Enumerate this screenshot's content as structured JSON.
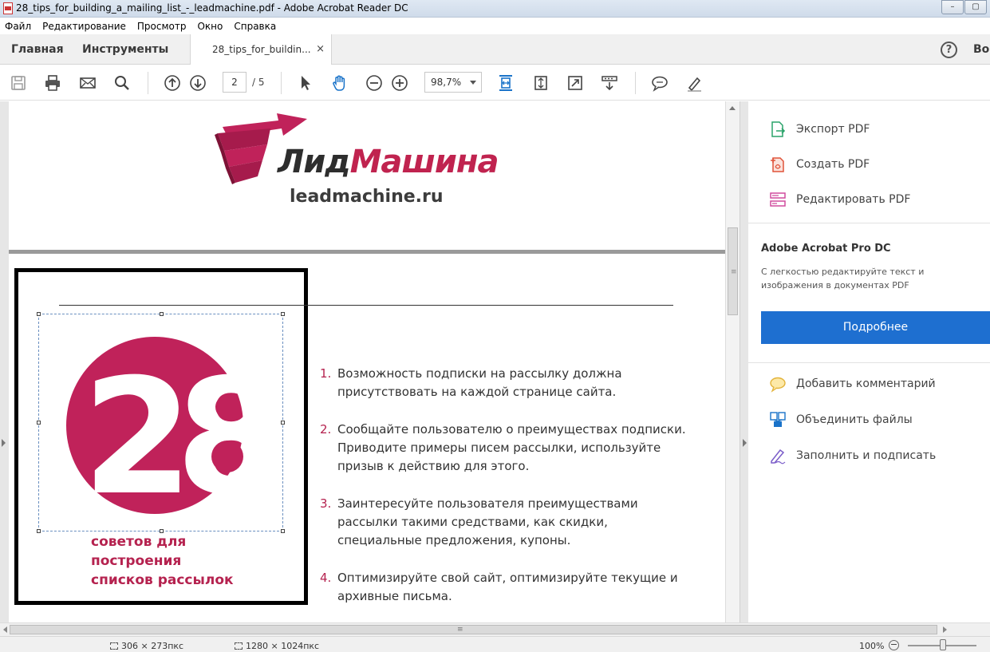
{
  "window": {
    "title": "28_tips_for_building_a_mailing_list_-_leadmachine.pdf - Adobe Acrobat Reader DC",
    "buttons": [
      "–",
      "▢"
    ]
  },
  "menu": [
    "Файл",
    "Редактирование",
    "Просмотр",
    "Окно",
    "Справка"
  ],
  "tabs": {
    "home": "Главная",
    "tools": "Инструменты",
    "document": "28_tips_for_buildin...",
    "close": "×",
    "help": "?",
    "signin": "Во"
  },
  "toolbar": {
    "page_current": "2",
    "page_total": "/ 5",
    "zoom": "98,7%",
    "icons": [
      "save-icon",
      "print-icon",
      "email-icon",
      "search-icon",
      "page-up-icon",
      "page-down-icon",
      "select-cursor-icon",
      "hand-icon",
      "zoom-out-icon",
      "zoom-in-icon",
      "fit-page-icon",
      "rotate-icon",
      "fullscreen-icon",
      "scroll-mode-icon",
      "comment-icon",
      "highlight-icon"
    ]
  },
  "document": {
    "logo_text_a": "Лид",
    "logo_text_b": "Машина",
    "logo_url": "leadmachine.ru",
    "badge_number": "28",
    "caption_lines": [
      "советов для",
      "построения",
      "списков рассылок"
    ],
    "list": [
      {
        "n": "1.",
        "text": "Возможность подписки на рассылку должна присутствовать на каждой странице сайта."
      },
      {
        "n": "2.",
        "text": "Сообщайте пользователю о преимуществах подписки. Приводите примеры писем рассылки, используйте призыв к действию для этого."
      },
      {
        "n": "3.",
        "text": "Заинтересуйте пользователя преимуществами рассылки такими средствами, как скидки, специальные предложения, купоны."
      },
      {
        "n": "4.",
        "text": "Оптимизируйте свой сайт, оптимизируйте текущие и архивные письма."
      }
    ],
    "colors": {
      "brand": "#c0225a",
      "list_number": "#b5224f"
    }
  },
  "rightpane": {
    "tools_top": [
      {
        "label": "Экспорт PDF",
        "icon": "export-pdf-icon"
      },
      {
        "label": "Создать PDF",
        "icon": "create-pdf-icon"
      },
      {
        "label": "Редактировать PDF",
        "icon": "edit-pdf-icon"
      }
    ],
    "promo_title": "Adobe Acrobat Pro DC",
    "promo_desc": "С легкостью редактируйте текст и изображения в документах PDF",
    "promo_button": "Подробнее",
    "tools_bottom": [
      {
        "label": "Добавить комментарий",
        "icon": "add-comment-icon"
      },
      {
        "label": "Объединить файлы",
        "icon": "combine-files-icon"
      },
      {
        "label": "Заполнить и подписать",
        "icon": "fill-sign-icon"
      }
    ],
    "accent": "#1e6fd0"
  },
  "status": {
    "selection_size": "306 × 273пкс",
    "image_size": "1280 × 1024пкс",
    "zoom_pct": "100%",
    "zoom_minus": "−",
    "scroll_grip": "≡"
  }
}
